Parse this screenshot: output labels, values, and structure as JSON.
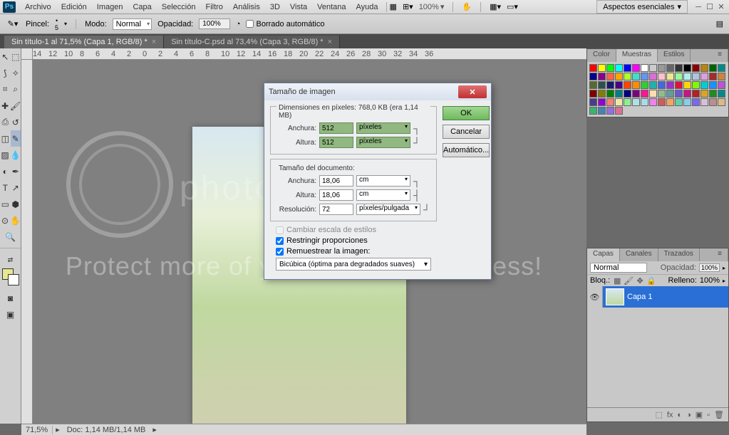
{
  "menubar": {
    "items": [
      "Archivo",
      "Edición",
      "Imagen",
      "Capa",
      "Selección",
      "Filtro",
      "Análisis",
      "3D",
      "Vista",
      "Ventana",
      "Ayuda"
    ],
    "zoom_dd": "100%",
    "workspace": "Aspectos esenciales"
  },
  "optbar": {
    "brush_label": "Pincel:",
    "brush_size": "5",
    "mode_label": "Modo:",
    "mode_value": "Normal",
    "opacity_label": "Opacidad:",
    "opacity_value": "100%",
    "auto_erase": "Borrado automático"
  },
  "tabs": [
    {
      "label": "Sin título-1 al 71,5% (Capa 1, RGB/8) *",
      "active": true
    },
    {
      "label": "Sin título-C.psd al 73,4% (Capa 3, RGB/8) *",
      "active": false
    }
  ],
  "ruler_ticks": [
    "14",
    "12",
    "10",
    "8",
    "6",
    "4",
    "2",
    "0",
    "2",
    "4",
    "6",
    "8",
    "10",
    "12",
    "14",
    "16",
    "18",
    "20",
    "22",
    "24",
    "26",
    "28",
    "30",
    "32",
    "34",
    "36"
  ],
  "statusbar": {
    "zoom": "71,5%",
    "doc": "Doc: 1,14 MB/1,14 MB"
  },
  "panels": {
    "swatch_tabs": [
      "Color",
      "Muestras",
      "Estilos"
    ],
    "layer_tabs": [
      "Capas",
      "Canales",
      "Trazados"
    ],
    "blend_mode": "Normal",
    "opacity_label": "Opacidad:",
    "opacity_val": "100%",
    "lock_label": "Bloq.:",
    "fill_label": "Relleno:",
    "fill_val": "100%",
    "layer_name": "Capa 1"
  },
  "swatches": [
    "#ff0000",
    "#ffff00",
    "#00ff00",
    "#00ffff",
    "#0000ff",
    "#ff00ff",
    "#ffffff",
    "#cccccc",
    "#999999",
    "#666666",
    "#333333",
    "#000000",
    "#8b0000",
    "#b8860b",
    "#006400",
    "#008b8b",
    "#00008b",
    "#8b008b",
    "#ff6347",
    "#ffa500",
    "#adff2f",
    "#40e0d0",
    "#6495ed",
    "#da70d6",
    "#ffc0cb",
    "#f0e68c",
    "#98fb98",
    "#afeeee",
    "#b0c4de",
    "#dda0dd",
    "#a52a2a",
    "#cd853f",
    "#556b2f",
    "#2f4f4f",
    "#191970",
    "#4b0082",
    "#ff4500",
    "#ff8c00",
    "#32cd32",
    "#20b2aa",
    "#4169e1",
    "#9932cc",
    "#dc143c",
    "#ffd700",
    "#7cfc00",
    "#00ced1",
    "#1e90ff",
    "#ba55d3",
    "#800000",
    "#808000",
    "#008000",
    "#008080",
    "#000080",
    "#800080",
    "#ff1493",
    "#ffdead",
    "#8fbc8f",
    "#5f9ea0",
    "#6a5acd",
    "#c71585",
    "#b22222",
    "#daa520",
    "#228b22",
    "#008b8b",
    "#483d8b",
    "#9400d3",
    "#fa8072",
    "#eee8aa",
    "#90ee90",
    "#b0e0e6",
    "#add8e6",
    "#ee82ee",
    "#cd5c5c",
    "#f4a460",
    "#66cdaa",
    "#87ceeb",
    "#7b68ee",
    "#d8bfd8",
    "#bc8f8f",
    "#deb887",
    "#3cb371",
    "#4682b4",
    "#9370db",
    "#db7093"
  ],
  "dialog": {
    "title": "Tamaño de imagen",
    "pixel_dims": "Dimensiones en píxeles: 768,0 KB (era 1,14 MB)",
    "width_label": "Anchura:",
    "height_label": "Altura:",
    "px_width": "512",
    "px_height": "512",
    "px_unit": "píxeles",
    "doc_size": "Tamaño del documento:",
    "doc_width": "18,06",
    "doc_height": "18,06",
    "doc_unit": "cm",
    "res_label": "Resolución:",
    "res_value": "72",
    "res_unit": "píxeles/pulgada",
    "scale_styles": "Cambiar escala de estilos",
    "constrain": "Restringir proporciones",
    "resample": "Remuestrear la imagen:",
    "method": "Bicúbica (óptima para degradados suaves)",
    "ok": "OK",
    "cancel": "Cancelar",
    "auto": "Automático..."
  },
  "watermark": {
    "line1": "photobucket",
    "line2": "Protect more of your memories for less!"
  }
}
